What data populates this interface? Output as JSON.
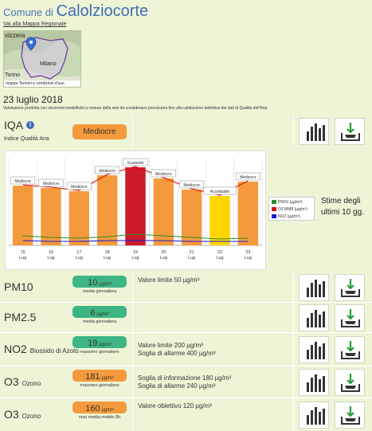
{
  "header": {
    "comune_prefix": "Comune di",
    "city": "Calolziocorte",
    "map_link": "Vai alla Mappa Regionale",
    "map_labels": {
      "top": "vizzera",
      "milano": "Milano",
      "torino": "Torino"
    },
    "map_footer": "mappa  Termini e condizioni d'uso",
    "date": "23 luglio 2018",
    "note": "Valutazione prodotta con strumenti modellistici e misure della rete da considerarsi provvisoria fino alla validazione definitiva dei dati di Qualità dell'Aria"
  },
  "iqa": {
    "title": "IQA",
    "info": "i",
    "subtitle": "Indice Qualità Aria",
    "badge": "Mediocre"
  },
  "chart_data": {
    "type": "bar",
    "categories": [
      "15 Lug",
      "16 Lug",
      "17 Lug",
      "18 Lug",
      "19 Lug",
      "20 Lug",
      "21 Lug",
      "22 Lug",
      "23 Lug"
    ],
    "x_ticks": [
      [
        "15",
        "Lug"
      ],
      [
        "16",
        "Lug"
      ],
      [
        "17",
        "Lug"
      ],
      [
        "18",
        "Lug"
      ],
      [
        "19",
        "Lug"
      ],
      [
        "20",
        "Lug"
      ],
      [
        "21",
        "Lug"
      ],
      [
        "22",
        "Lug"
      ],
      [
        "23",
        "Lug"
      ]
    ],
    "values": [
      75,
      72,
      68,
      88,
      98,
      84,
      70,
      62,
      80
    ],
    "labels": [
      "Mediocre",
      "Mediocre",
      "Mediocre",
      "Mediocre",
      "Scadente",
      "Mediocre",
      "Mediocre",
      "Accettabile",
      "Mediocre"
    ],
    "bar_colors": [
      "#f59a3c",
      "#f59a3c",
      "#f59a3c",
      "#f59a3c",
      "#cc1a2a",
      "#f59a3c",
      "#f59a3c",
      "#ffd500",
      "#f59a3c"
    ],
    "ylim": [
      0,
      110
    ],
    "series": [
      {
        "name": "PM10 (µg/m³)",
        "color": "#2e8b2e",
        "values": [
          12,
          10,
          9,
          11,
          14,
          12,
          10,
          8,
          9
        ]
      },
      {
        "name": "O3 MM8 (µg/m³)",
        "color": "#dd1111",
        "values": [
          76,
          73,
          69,
          89,
          99,
          85,
          71,
          63,
          81
        ]
      },
      {
        "name": "NO2 (µg/m³)",
        "color": "#1a1ad8",
        "values": [
          6,
          5,
          5,
          6,
          6,
          6,
          5,
          5,
          5
        ]
      }
    ]
  },
  "chart_side": {
    "line1": "Stime degli",
    "line2": "ultimi 10 gg."
  },
  "pollutants": [
    {
      "name": "PM10",
      "suffix": "",
      "value": "10",
      "unit": "µg/m³",
      "caption": "media giornaliera",
      "color": "green",
      "limits": [
        "Valore limite 50 µg/m³"
      ]
    },
    {
      "name": "PM2.5",
      "suffix": "",
      "value": "6",
      "unit": "µg/m³",
      "caption": "media giornaliera",
      "color": "green",
      "limits": []
    },
    {
      "name": "NO2",
      "suffix": "Biossido di Azoto",
      "value": "19",
      "unit": "µg/m³",
      "caption": "massimo giornaliero",
      "color": "green",
      "limits": [
        "Valore limite 200 µg/m³",
        "Soglia di allarme 400 µg/m³"
      ]
    },
    {
      "name": "O3",
      "suffix": "Ozono",
      "value": "181",
      "unit": "µg/m³",
      "caption": "massimo giornaliero",
      "color": "orange",
      "limits": [
        "Soglia di informazione 180 µg/m³",
        "Soglia di allarme 240 µg/m³"
      ]
    },
    {
      "name": "O3",
      "suffix": "Ozono",
      "value": "160",
      "unit": "µg/m³",
      "caption": "max media mobile 8h",
      "color": "orange",
      "limits": [
        "Valore obiettivo 120 µg/m³"
      ]
    }
  ],
  "colors": {
    "panel": "#eef4d6",
    "accent": "#3f6db3",
    "orange": "#f59a3c",
    "green": "#3db584"
  },
  "icons": {
    "chart": "bar-chart-icon",
    "download": "download-tray-icon"
  }
}
